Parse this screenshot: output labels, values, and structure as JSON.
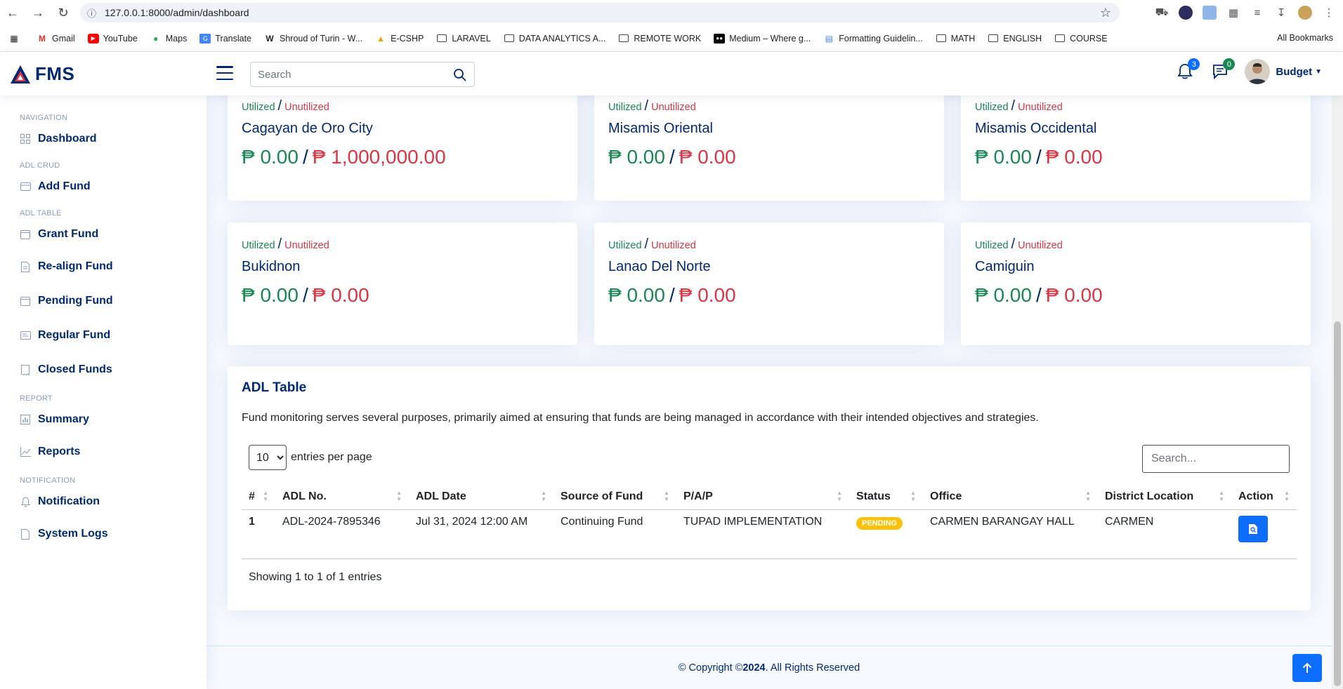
{
  "browser": {
    "url": "127.0.0.1:8000/admin/dashboard",
    "bookmarks": [
      {
        "label": "Gmail",
        "icon": "gmail-icon"
      },
      {
        "label": "YouTube",
        "icon": "youtube-icon"
      },
      {
        "label": "Maps",
        "icon": "maps-icon"
      },
      {
        "label": "Translate",
        "icon": "translate-icon"
      },
      {
        "label": "Shroud of Turin - W...",
        "icon": "wikipedia-icon"
      },
      {
        "label": "E-CSHP",
        "icon": "ecshp-icon"
      },
      {
        "label": "LARAVEL",
        "icon": "folder-icon"
      },
      {
        "label": "DATA ANALYTICS A...",
        "icon": "folder-icon"
      },
      {
        "label": "REMOTE WORK",
        "icon": "folder-icon"
      },
      {
        "label": "Medium – Where g...",
        "icon": "medium-icon"
      },
      {
        "label": "Formatting Guidelin...",
        "icon": "doc-icon"
      },
      {
        "label": "MATH",
        "icon": "folder-icon"
      },
      {
        "label": "ENGLISH",
        "icon": "folder-icon"
      },
      {
        "label": "COURSE",
        "icon": "folder-icon"
      }
    ],
    "all_bookmarks": "All Bookmarks"
  },
  "header": {
    "logo": "FMS",
    "search_placeholder": "Search",
    "notifications_count": "3",
    "messages_count": "0",
    "profile_name": "Budget"
  },
  "sidebar": {
    "sections": [
      {
        "heading": "NAVIGATION",
        "items": [
          {
            "label": "Dashboard",
            "icon": "grid-icon"
          }
        ]
      },
      {
        "heading": "ADL CRUD",
        "items": [
          {
            "label": "Add Fund",
            "icon": "card-icon"
          }
        ]
      },
      {
        "heading": "ADL TABLE",
        "items": [
          {
            "label": "Grant Fund",
            "icon": "calendar-icon"
          },
          {
            "label": "Re-align Fund",
            "icon": "document-icon"
          },
          {
            "label": "Pending Fund",
            "icon": "calendar-icon"
          },
          {
            "label": "Regular Fund",
            "icon": "card-text-icon"
          },
          {
            "label": "Closed Funds",
            "icon": "receipt-icon"
          }
        ]
      },
      {
        "heading": "REPORT",
        "items": [
          {
            "label": "Summary",
            "icon": "bar-chart-icon"
          },
          {
            "label": "Reports",
            "icon": "line-chart-icon"
          }
        ]
      },
      {
        "heading": "NOTIFICATION",
        "items": [
          {
            "label": "Notification",
            "icon": "bell-icon"
          },
          {
            "label": "System Logs",
            "icon": "file-icon"
          }
        ]
      }
    ]
  },
  "cards": [
    {
      "utilized": "Utilized",
      "unutilized": "Unutilized",
      "place": "Cagayan de Oro City",
      "utilized_amount": "₱ 0.00",
      "unutilized_amount": "₱ 1,000,000.00"
    },
    {
      "utilized": "Utilized",
      "unutilized": "Unutilized",
      "place": "Misamis Oriental",
      "utilized_amount": "₱ 0.00",
      "unutilized_amount": "₱ 0.00"
    },
    {
      "utilized": "Utilized",
      "unutilized": "Unutilized",
      "place": "Misamis Occidental",
      "utilized_amount": "₱ 0.00",
      "unutilized_amount": "₱ 0.00"
    },
    {
      "utilized": "Utilized",
      "unutilized": "Unutilized",
      "place": "Bukidnon",
      "utilized_amount": "₱ 0.00",
      "unutilized_amount": "₱ 0.00"
    },
    {
      "utilized": "Utilized",
      "unutilized": "Unutilized",
      "place": "Lanao Del Norte",
      "utilized_amount": "₱ 0.00",
      "unutilized_amount": "₱ 0.00"
    },
    {
      "utilized": "Utilized",
      "unutilized": "Unutilized",
      "place": "Camiguin",
      "utilized_amount": "₱ 0.00",
      "unutilized_amount": "₱ 0.00"
    }
  ],
  "adl_table": {
    "title": "ADL Table",
    "description": "Fund monitoring serves several purposes, primarily aimed at ensuring that funds are being managed in accordance with their intended objectives and strategies.",
    "per_page_value": "10",
    "per_page_label": "entries per page",
    "search_placeholder": "Search...",
    "columns": [
      "#",
      "ADL No.",
      "ADL Date",
      "Source of Fund",
      "P/A/P",
      "Status",
      "Office",
      "District Location",
      "Action"
    ],
    "rows": [
      {
        "num": "1",
        "adl_no": "ADL-2024-7895346",
        "adl_date": "Jul 31, 2024 12:00 AM",
        "source": "Continuing Fund",
        "pap": "TUPAD IMPLEMENTATION",
        "status": "PENDING",
        "office": "CARMEN BARANGAY HALL",
        "district": "CARMEN"
      }
    ],
    "showing": "Showing 1 to 1 of 1 entries"
  },
  "footer": {
    "prefix": "© Copyright © ",
    "year": "2024",
    "suffix": ". All Rights Reserved"
  },
  "colors": {
    "primary": "#012970",
    "utilized": "#198754",
    "unutilized": "#dc3545",
    "button": "#0d6efd",
    "pending": "#ffc107"
  }
}
